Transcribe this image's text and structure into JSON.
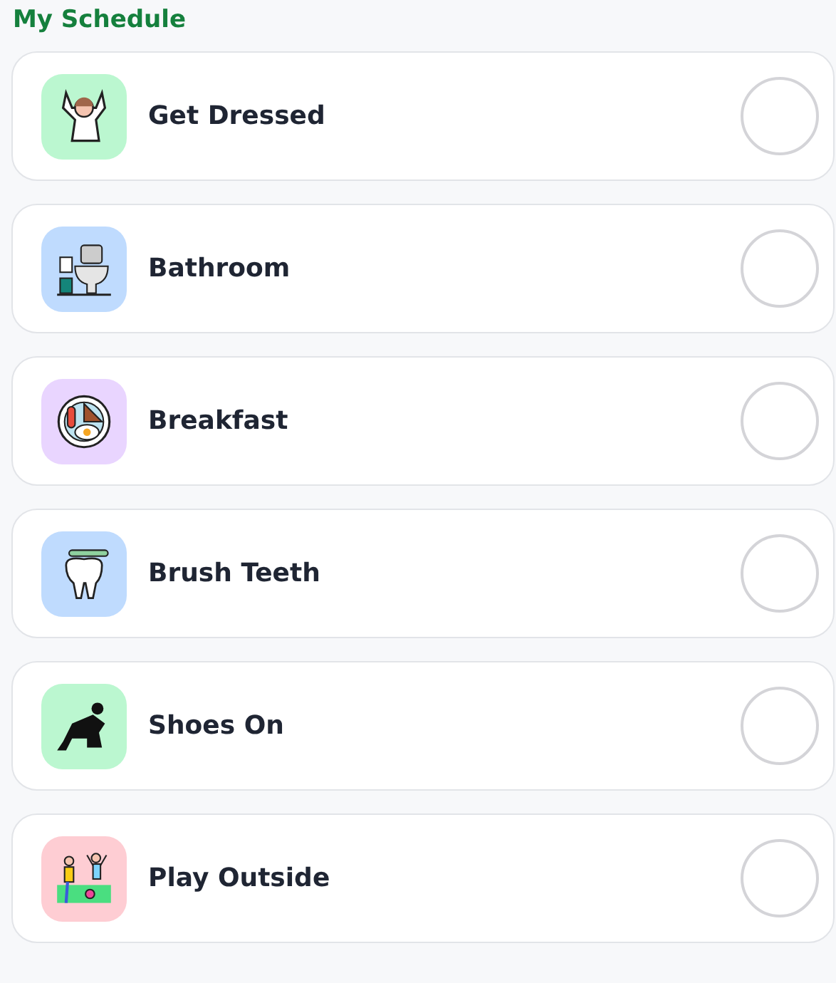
{
  "title": "My Schedule",
  "tasks": [
    {
      "label": "Get Dressed",
      "color": "#bbf7d0",
      "checked": false
    },
    {
      "label": "Bathroom",
      "color": "#bfdbfe",
      "checked": false
    },
    {
      "label": "Breakfast",
      "color": "#e9d5ff",
      "checked": false
    },
    {
      "label": "Brush Teeth",
      "color": "#bfdbfe",
      "checked": false
    },
    {
      "label": "Shoes On",
      "color": "#bbf7d0",
      "checked": false
    },
    {
      "label": "Play Outside",
      "color": "#fecdd3",
      "checked": false
    }
  ]
}
